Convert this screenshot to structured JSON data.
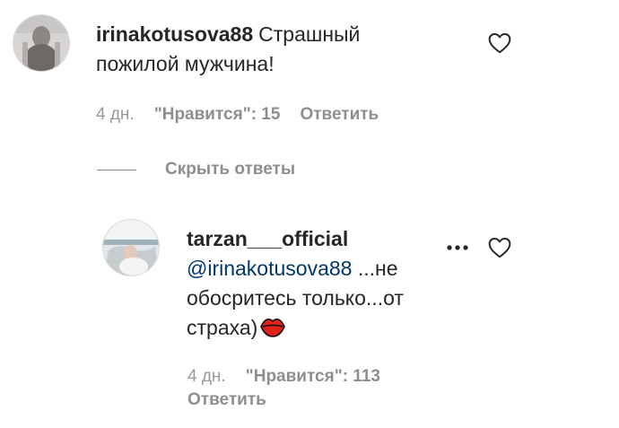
{
  "comment": {
    "username": "irinakotusova88",
    "text_line1": "Страшный",
    "text_line2": "пожилой мужчина!",
    "date": "4 дн.",
    "likes": "\"Нравится\": 15",
    "reply_label": "Ответить"
  },
  "hide_replies_label": "Скрыть ответы",
  "reply": {
    "username": "tarzan___official",
    "mention": "@irinakotusova88",
    "text_line1_rest": " ...не",
    "text_line2": "обосритесь только...от",
    "text_line3": "страха)",
    "emoji": "lips-icon",
    "date": "4 дн.",
    "likes": "\"Нравится\": 113",
    "reply_label": "Ответить"
  },
  "colors": {
    "text": "#262626",
    "secondary": "#8e8e8e",
    "mention": "#00376b",
    "lips": "#e0201b"
  }
}
